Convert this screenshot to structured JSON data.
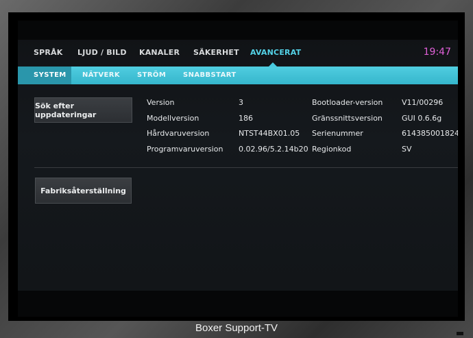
{
  "nav": {
    "tabs": [
      {
        "label": "SPRÅK"
      },
      {
        "label": "LJUD / BILD"
      },
      {
        "label": "KANALER"
      },
      {
        "label": "SÄKERHET"
      },
      {
        "label": "AVANCERAT"
      }
    ],
    "active_tab": "AVANCERAT",
    "clock": "19:47"
  },
  "subnav": {
    "tabs": [
      {
        "label": "SYSTEM"
      },
      {
        "label": "NÄTVERK"
      },
      {
        "label": "STRÖM"
      },
      {
        "label": "SNABBSTART"
      }
    ],
    "active_tab": "SYSTEM"
  },
  "buttons": {
    "check_updates": "Sök efter uppdateringar",
    "factory_reset": "Fabriksåterställning"
  },
  "system_info": {
    "left": [
      {
        "label": "Version",
        "value": "3"
      },
      {
        "label": "Modellversion",
        "value": "186"
      },
      {
        "label": "Hårdvaruversion",
        "value": "NTST44BX01.05"
      },
      {
        "label": "Programvaruversion",
        "value": "0.02.96/5.2.14b20"
      }
    ],
    "right": [
      {
        "label": "Bootloader-version",
        "value": "V11/00296"
      },
      {
        "label": "Gränssnittsversion",
        "value": "GUI 0.6.6g"
      },
      {
        "label": "Serienummer",
        "value": "614385001824"
      },
      {
        "label": "Regionkod",
        "value": "SV"
      }
    ]
  },
  "caption": "Boxer Support-TV",
  "colors": {
    "accent": "#47c8de",
    "clock": "#e060d8",
    "background": "#13171a"
  }
}
